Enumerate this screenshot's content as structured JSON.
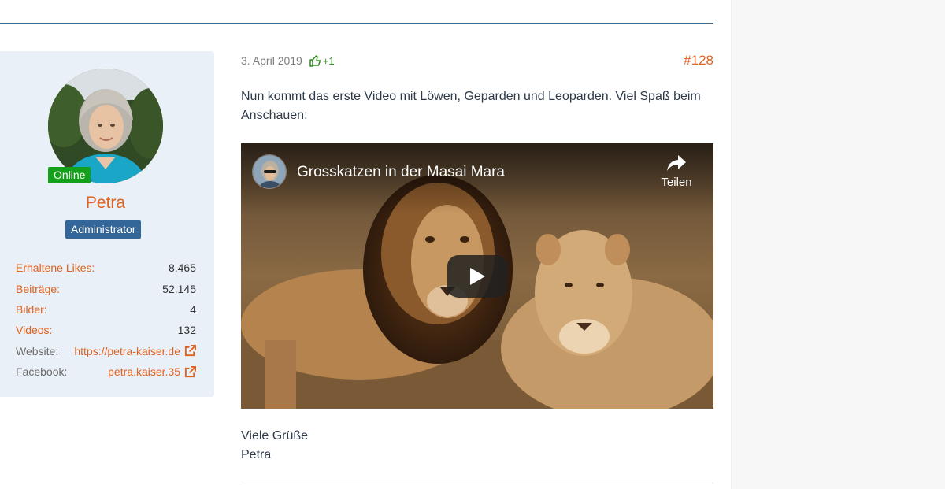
{
  "user": {
    "online_label": "Online",
    "name": "Petra",
    "role": "Administrator",
    "stats": [
      {
        "label": "Erhaltene Likes:",
        "value": "8.465"
      },
      {
        "label": "Beiträge:",
        "value": "52.145"
      },
      {
        "label": "Bilder:",
        "value": "4"
      },
      {
        "label": "Videos:",
        "value": "132"
      }
    ],
    "website_label": "Website:",
    "website_value": "https://petra-kaiser.de",
    "facebook_label": "Facebook:",
    "facebook_value": "petra.kaiser.35"
  },
  "post": {
    "date": "3. April 2019",
    "likes": "+1",
    "number": "#128",
    "body": "Nun kommt das erste Video mit Löwen, Geparden und Leoparden. Viel Spaß beim Anschauen:",
    "greeting": "Viele Grüße",
    "signature": "Petra"
  },
  "video": {
    "title": "Grosskatzen in der Masai Mara",
    "share_label": "Teilen"
  },
  "colors": {
    "accent": "#e0621e",
    "online": "#14a01a",
    "role": "#336699",
    "like": "#2f8a1e",
    "card": "#eaf0f7"
  },
  "icons": [
    "thumbs-up-icon",
    "external-link-icon",
    "share-icon",
    "play-icon"
  ]
}
